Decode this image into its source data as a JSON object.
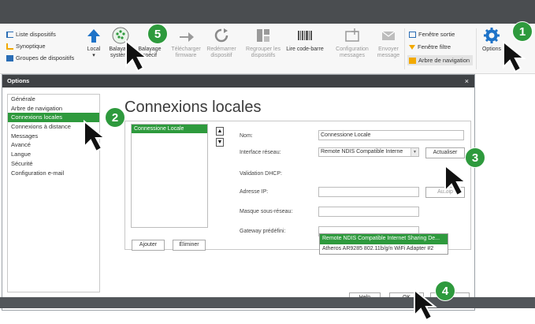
{
  "ribbon": {
    "left_links": [
      {
        "label": "Liste dispositifs",
        "color": "#2a6db5"
      },
      {
        "label": "Synoptique",
        "color": "#f2a900"
      },
      {
        "label": "Groupes de dispositifs",
        "color": "#2a6db5"
      }
    ],
    "buttons": [
      {
        "label": "Local",
        "icon": "arrow-up-icon"
      },
      {
        "label": "Balayage système",
        "icon": "scan-icon"
      },
      {
        "label": "Balayage spécif",
        "icon": "scan-specific-icon"
      },
      {
        "label": "Télécharger firmware",
        "icon": "arrow-right-icon"
      },
      {
        "label": "Redémarrer dispositif",
        "icon": "restart-icon"
      },
      {
        "label": "Regrouper les dispositifs",
        "icon": "group-icon"
      },
      {
        "label": "Lire code-barre",
        "icon": "barcode-icon"
      },
      {
        "label": "Configuration messages",
        "icon": "message-config-icon"
      },
      {
        "label": "Envoyer message",
        "icon": "envelope-icon"
      }
    ],
    "window_options": [
      {
        "label": "Fenêtre sortie",
        "icon": "window-icon"
      },
      {
        "label": "Fenêtre filtre",
        "icon": "filter-icon"
      },
      {
        "label": "Arbre de navigation",
        "icon": "tree-icon"
      }
    ],
    "options_label": "Options"
  },
  "dialog": {
    "title": "Options",
    "close": "×",
    "nav_items": [
      "Générale",
      "Arbre de navigation",
      "Connexions locales",
      "Connexions à distance",
      "Messages",
      "Avancé",
      "Langue",
      "Sécurité",
      "Configuration e-mail"
    ],
    "nav_selected_index": 2,
    "heading": "Connexions locales",
    "connection_list": [
      "Connessione Locale"
    ],
    "add_label": "Ajouter",
    "remove_label": "Éliminer",
    "fields": {
      "name_label": "Nom:",
      "name_value": "Connessione Locale",
      "interface_label": "Interface réseau:",
      "interface_value": "Remote NDIS Compatible Interne",
      "refresh_label": "Actualiser",
      "dhcp_label": "Validation DHCP:",
      "ip_label": "Adresse IP:",
      "autoip_label": "Autoip",
      "mask_label": "Masque sous-réseau:",
      "gateway_label": "Gateway prédéfini:"
    },
    "dropdown_options": [
      "Remote NDIS Compatible Internet Sharing De...",
      "Atheros AR9285 802.11b/g/n WiFi Adapter #2"
    ],
    "dropdown_highlight_index": 0,
    "help_label": "Help",
    "ok_label": "OK"
  },
  "steps": [
    "1",
    "2",
    "3",
    "4",
    "5"
  ],
  "colors": {
    "accent": "#2e9a3d",
    "titlebar": "#3f4245"
  }
}
